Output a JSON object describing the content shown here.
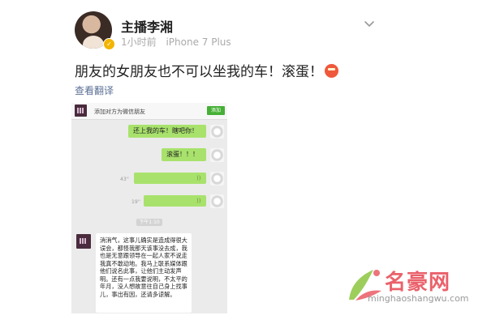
{
  "post": {
    "author_name": "主播李湘",
    "time_ago": "1小时前",
    "device": "iPhone 7 Plus",
    "text": "朋友的女朋友也不可以坐我的车！滚蛋！",
    "translate_label": "查看翻译"
  },
  "chat_screenshot": {
    "add_friend_prompt": "添加对方为微信朋友",
    "add_button_label": "添加",
    "messages": [
      "还上我的车！瞎吧你！",
      "滚蛋！！！"
    ],
    "voice_lengths": [
      "43''",
      "19''"
    ],
    "timestamp": "下午1:10",
    "long_message": "消消气，这事儿确实是造成得很大误会，都怪我那天该事没去成，我也是无意跟领导在一起人家不说走我真不敢动地。我马上联系媒体跟他们说名此事，让他们主动发声明。还有一点我要说明，不太平的年月，没人想故意往自己身上找事儿，事出有因，还请多谅解。"
  },
  "watermark": {
    "title": "名豪网",
    "url": "minghaoshangwu.com"
  },
  "colors": {
    "accent_link": "#5b6f96",
    "wechat_green": "#a8e26c",
    "watermark_red": "#e8505b"
  }
}
